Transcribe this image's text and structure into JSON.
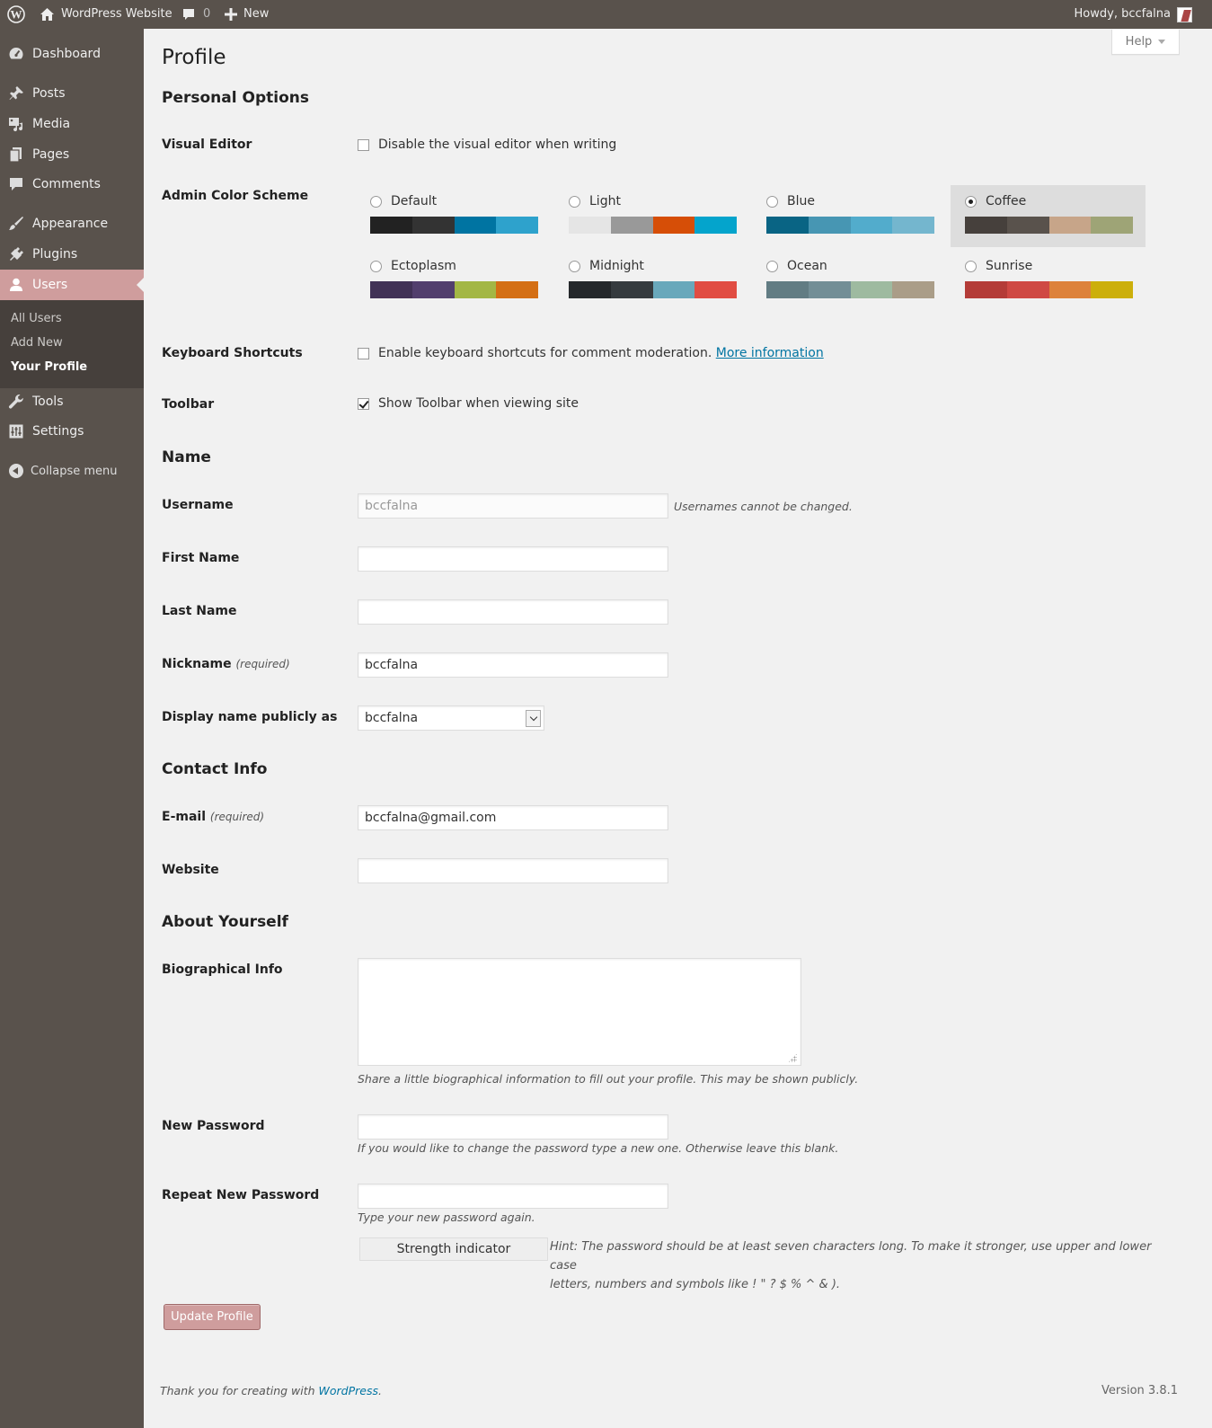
{
  "adminbar": {
    "site_name": "WordPress Website",
    "comments_count": "0",
    "new_label": "New",
    "howdy": "Howdy, bccfalna"
  },
  "sidebar": {
    "items": [
      {
        "label": "Dashboard",
        "icon": "dashboard-icon"
      },
      {
        "label": "Posts",
        "icon": "pin-icon"
      },
      {
        "label": "Media",
        "icon": "media-icon"
      },
      {
        "label": "Pages",
        "icon": "pages-icon"
      },
      {
        "label": "Comments",
        "icon": "comment-icon"
      },
      {
        "label": "Appearance",
        "icon": "brush-icon"
      },
      {
        "label": "Plugins",
        "icon": "plug-icon"
      },
      {
        "label": "Users",
        "icon": "user-icon"
      },
      {
        "label": "Tools",
        "icon": "wrench-icon"
      },
      {
        "label": "Settings",
        "icon": "settings-icon"
      }
    ],
    "submenu": [
      "All Users",
      "Add New",
      "Your Profile"
    ],
    "collapse": "Collapse menu"
  },
  "help": "Help",
  "page_title": "Profile",
  "personal": {
    "heading": "Personal Options",
    "visual_editor_label": "Visual Editor",
    "visual_editor_text": "Disable the visual editor when writing",
    "color_scheme_label": "Admin Color Scheme",
    "schemes": [
      {
        "name": "Default",
        "colors": [
          "#222222",
          "#333333",
          "#0074a2",
          "#2ea2cc"
        ],
        "selected": false
      },
      {
        "name": "Light",
        "colors": [
          "#e5e5e5",
          "#999999",
          "#d64e07",
          "#04a4cc"
        ],
        "selected": false
      },
      {
        "name": "Blue",
        "colors": [
          "#096484",
          "#4796b3",
          "#52accc",
          "#74B6CE"
        ],
        "selected": false
      },
      {
        "name": "Coffee",
        "colors": [
          "#46403c",
          "#59524c",
          "#c7a589",
          "#9ea476"
        ],
        "selected": true
      },
      {
        "name": "Ectoplasm",
        "colors": [
          "#413256",
          "#523f6d",
          "#a3b745",
          "#d46f15"
        ],
        "selected": false
      },
      {
        "name": "Midnight",
        "colors": [
          "#25282b",
          "#363b3f",
          "#69a8bb",
          "#e14d43"
        ],
        "selected": false
      },
      {
        "name": "Ocean",
        "colors": [
          "#627c83",
          "#738e96",
          "#9ebaa0",
          "#aa9d88"
        ],
        "selected": false
      },
      {
        "name": "Sunrise",
        "colors": [
          "#b43c38",
          "#cf4944",
          "#dd823b",
          "#ccaf0b"
        ],
        "selected": false
      }
    ],
    "keyboard_label": "Keyboard Shortcuts",
    "keyboard_text": "Enable keyboard shortcuts for comment moderation.",
    "keyboard_link": "More information",
    "toolbar_label": "Toolbar",
    "toolbar_text": "Show Toolbar when viewing site"
  },
  "name_section": {
    "heading": "Name",
    "username_label": "Username",
    "username_value": "bccfalna",
    "username_desc": "Usernames cannot be changed.",
    "first_name_label": "First Name",
    "first_name_value": "",
    "last_name_label": "Last Name",
    "last_name_value": "",
    "nickname_label": "Nickname",
    "required": "(required)",
    "nickname_value": "bccfalna",
    "display_label": "Display name publicly as",
    "display_value": "bccfalna"
  },
  "contact": {
    "heading": "Contact Info",
    "email_label": "E-mail",
    "email_value": "bccfalna@gmail.com",
    "website_label": "Website",
    "website_value": ""
  },
  "about": {
    "heading": "About Yourself",
    "bio_label": "Biographical Info",
    "bio_desc": "Share a little biographical information to fill out your profile. This may be shown publicly.",
    "new_pass_label": "New Password",
    "new_pass_desc": "If you would like to change the password type a new one. Otherwise leave this blank.",
    "repeat_pass_label": "Repeat New Password",
    "repeat_pass_desc": "Type your new password again.",
    "strength": "Strength indicator",
    "hint_line1": "Hint: The password should be at least seven characters long. To make it stronger, use upper and lower case",
    "hint_line2": "letters, numbers and symbols like ! \" ? $ % ^ & )."
  },
  "update_button": "Update Profile",
  "footer": {
    "thanks_prefix": "Thank you for creating with",
    "thanks_link": "WordPress",
    "thanks_suffix": ".",
    "version": "Version 3.8.1"
  }
}
